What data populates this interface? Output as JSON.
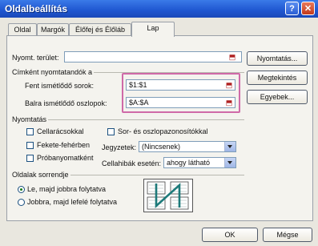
{
  "window": {
    "title": "Oldalbeállítás",
    "help": "?",
    "close": "✕"
  },
  "tabs": [
    "Oldal",
    "Margók",
    "Élőfej és Élőláb",
    "Lap"
  ],
  "print_area": {
    "label": "Nyomt. terület:",
    "value": ""
  },
  "titles_group": {
    "title": "Címként nyomtatandók a",
    "rows_label": "Fent ismétlődő sorok:",
    "rows_value": "$1:$1",
    "cols_label": "Balra ismétlődő oszlopok:",
    "cols_value": "$A:$A"
  },
  "print_group": {
    "title": "Nyomtatás",
    "gridlines": "Cellarácsokkal",
    "row_col_headers": "Sor- és oszlopazonosítókkal",
    "black_white": "Fekete-fehérben",
    "comments_label": "Jegyzetek:",
    "comments_value": "(Nincsenek)",
    "draft": "Próbanyomatként",
    "errors_label": "Cellahibák esetén:",
    "errors_value": "ahogy látható"
  },
  "order_group": {
    "title": "Oldalak sorrendje",
    "down_then_over": "Le, majd jobbra folytatva",
    "over_then_down": "Jobbra, majd lefelé folytatva"
  },
  "side_buttons": {
    "print": "Nyomtatás...",
    "preview": "Megtekintés",
    "options": "Egyebek..."
  },
  "footer": {
    "ok": "OK",
    "cancel": "Mégse"
  },
  "colors": {
    "title_bar": "#1f56d0",
    "highlight": "#cf6aa8"
  }
}
